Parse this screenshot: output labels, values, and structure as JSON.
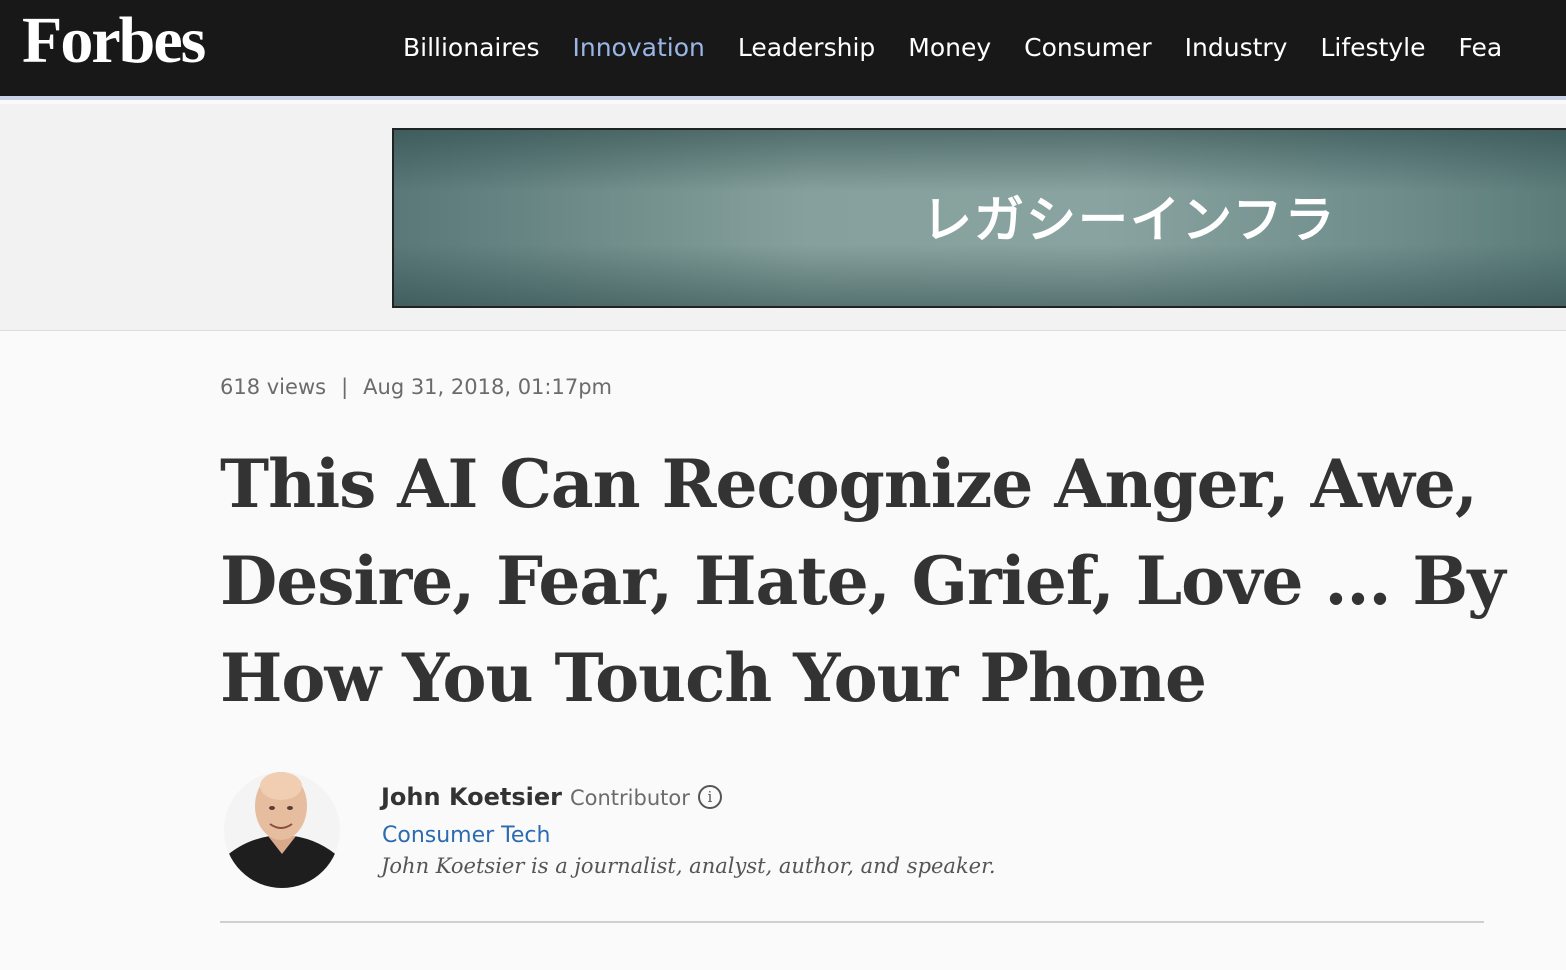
{
  "header": {
    "logo": "Forbes",
    "nav": [
      {
        "label": "Billionaires",
        "active": false
      },
      {
        "label": "Innovation",
        "active": true
      },
      {
        "label": "Leadership",
        "active": false
      },
      {
        "label": "Money",
        "active": false
      },
      {
        "label": "Consumer",
        "active": false
      },
      {
        "label": "Industry",
        "active": false
      },
      {
        "label": "Lifestyle",
        "active": false
      },
      {
        "label": "Fea",
        "active": false
      }
    ],
    "active_color": "#9ab6e6"
  },
  "ad": {
    "text": "レガシーインフラ"
  },
  "article": {
    "views": "618 views",
    "separator": "|",
    "date": "Aug 31, 2018, 01:17pm",
    "headline": "This AI Can Recognize Anger, Awe, Desire, Fear, Hate, Grief, Love ... By How You Touch Your Phone"
  },
  "author": {
    "name": "John Koetsier",
    "role": "Contributor",
    "info_icon": "info-icon",
    "channel": "Consumer Tech",
    "bio": "John Koetsier is a journalist, analyst, author, and speaker."
  }
}
